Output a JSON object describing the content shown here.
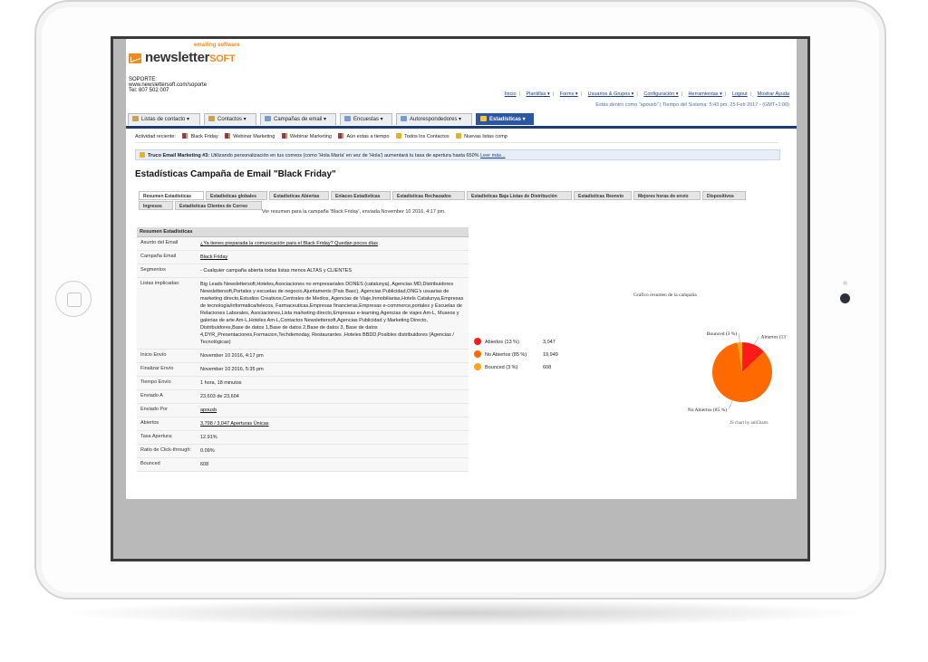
{
  "brand": {
    "name": "newsletter",
    "name_suffix": "SOFT",
    "tagline": "emailing software"
  },
  "support": {
    "line1": "SOPORTE:",
    "line2": "www.newslettersoft.com/soporte",
    "line3": "Tel: 807 502 007"
  },
  "toplinks": [
    "Inicio",
    "Plantillas ▾",
    "Forms ▾",
    "Usuarios & Grupos ▾",
    "Configuración ▾",
    "Herramientas ▾",
    "Logout",
    "Mostrar Ayuda"
  ],
  "status_line": "Estás dentro como \"apousb\" | Tiempo del Sistema: 5:43 pm, 25 Feb 2017 - (GMT+1:00)",
  "nav": [
    "Listas de contacto ▾",
    "Contactos ▾",
    "Campañas de email ▾",
    "Encuestas ▾",
    "Autorespondedores ▾",
    "Estadísticas ▾"
  ],
  "recent": {
    "label": "Actividad reciente:",
    "items": [
      "Black Friday",
      "Webinar Marketing",
      "Webinar Marketing",
      "Aún estas a tiempo",
      "Todos los Contactos",
      "Nuevas listas comp"
    ]
  },
  "tip": {
    "bold": "Truco Email Marketing #3:",
    "text": " Utilizando personalización en tus correos (como 'Hola María' en vez de 'Hola') aumentará tu tasa de apertura hasta 650%",
    "link": "Leer más..."
  },
  "page_title": "Estadísticas Campaña de Email \"Black Friday\"",
  "subtabs": [
    "Resumen Estadísticas",
    "Estadísticas globales",
    "Estadísticas Abiertas",
    "Enlaces Estadísticas",
    "Estadísticas Rechazados",
    "Estadísticas Baja Listas de Distribución",
    "Estadísticas Reenvío",
    "Mejores horas de envío",
    "Dispositivos",
    "Ingresos",
    "Estadísticas Clientes de Correo"
  ],
  "campaign_note": "Ver resumen para la campaña 'Black Friday', enviada November 10 2016, 4:17 pm.",
  "summary": {
    "header": "Resumen Estadísticas",
    "rows": [
      {
        "k": "Asunto del Email",
        "v": "¿Ya tienes preparada la comunicación para el Black Friday? Quedan pocos días"
      },
      {
        "k": "Campaña Email",
        "v": "Black Friday"
      },
      {
        "k": "Segmentos",
        "v": "- Cualquier campaña abierta todas listas menos ALTAS y CLIENTES"
      },
      {
        "k": "Listas implicadas:",
        "v": "Big Leads Newslettersoft,Hoteles,Asociaciones no empresariales DONES (catalunya), Agencias MD,Distribuidores Newslettersoft,Portales y escuelas de negocio,Ajuntaments (Pais Basc), Agencias Publicidad,ONG's usuarias de marketing directo,Estudios Creativos,Centrales de Medios, Agencias de Viaje,Inmobiliarias,Hotels Catalunya,Empresas de tecnologia/informatica/telecos, Farmaceuticas,Empresas financieras,Empresas e-commerce,portales y Escuelas de Relaciones Laborales, Asociaciones,Lista marketing directo,Empresas e-learning,Agencias de viajes Am-L, Museos y galerias de arte Am-L,Hoteles Am-L,Contactos Newslettersoft,Agencias Publicidad y Marketing Directo, Distribuidores,Base de datos 1,Base de datos 2,Base de datos 3, Base de datos 4,DYR_Presentaciones,Formacion,Techdemoday, Restaurantes ,Hoteles BBDD,Posibles distribuidores (Agencias / Tecnológicas)"
      },
      {
        "k": "Inicio Envío",
        "v": "November 10 2016, 4:17 pm"
      },
      {
        "k": "Finalizar Envío",
        "v": "November 10 2016, 5:35 pm"
      },
      {
        "k": "Tiempo Envío",
        "v": "1 hora, 18 minutos"
      },
      {
        "k": "Enviado A",
        "v": "23,603 de 23,604"
      },
      {
        "k": "Enviado Por",
        "v": "apousb"
      },
      {
        "k": "Abiertos",
        "v": "3,798 / 3,047 Aperturas Únicas"
      },
      {
        "k": "Tasa Apertura:",
        "v": "12.91%"
      },
      {
        "k": "Ratio de Click-through:",
        "v": "0.09%"
      },
      {
        "k": "Bounced",
        "v": "608"
      }
    ]
  },
  "chart_data": {
    "type": "pie",
    "title": "Gráfico resumen de la campaña",
    "categories": [
      "Abiertos (13 %)",
      "No Abiertos (85 %)",
      "Bounced (3 %)"
    ],
    "values": [
      3047,
      19949,
      608
    ],
    "value_labels": [
      "3,047",
      "19,949",
      "608"
    ],
    "colors": [
      "#ff1a1a",
      "#ff6a00",
      "#ffa31a"
    ],
    "legend_placement": "left",
    "credit": "JS chart by amCharts"
  }
}
